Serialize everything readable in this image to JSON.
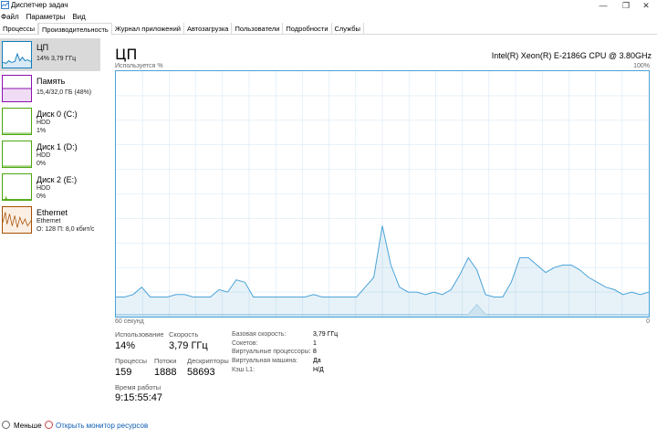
{
  "window": {
    "title": "Диспетчер задач",
    "accent": "#117dbb"
  },
  "menu": [
    "Файл",
    "Параметры",
    "Вид"
  ],
  "tabs": [
    "Процессы",
    "Производительность",
    "Журнал приложений",
    "Автозагрузка",
    "Пользователи",
    "Подробности",
    "Службы"
  ],
  "active_tab": "Производительность",
  "sidebar": [
    {
      "name": "ЦП",
      "sub1": "14% 3,79 ГГц",
      "sub2": "",
      "sub3": "",
      "color": "#117dbb"
    },
    {
      "name": "Память",
      "sub1": "15,4/32,0 ГБ (48%)",
      "sub2": "",
      "sub3": "",
      "color": "#8b12ae"
    },
    {
      "name": "Диск 0 (C:)",
      "sub1": "HDD",
      "sub2": "1%",
      "sub3": "",
      "color": "#4da60c"
    },
    {
      "name": "Диск 1 (D:)",
      "sub1": "HDD",
      "sub2": "0%",
      "sub3": "",
      "color": "#4da60c"
    },
    {
      "name": "Диск 2 (E:)",
      "sub1": "HDD",
      "sub2": "0%",
      "sub3": "",
      "color": "#4da60c"
    },
    {
      "name": "Ethernet",
      "sub1": "Ethernet",
      "sub2": "О: 128  П: 8,0 кбит/с",
      "sub3": "",
      "color": "#a74f01"
    }
  ],
  "main": {
    "title": "ЦП",
    "cpu_model": "Intel(R) Xeon(R) E-2186G CPU @ 3.80GHz",
    "graph_top_left": "Используется %",
    "graph_top_right": "100%",
    "graph_bottom_left": "60 секунд",
    "graph_bottom_right": "0",
    "cpu_history_percent": [
      8,
      8,
      9,
      12,
      8,
      8,
      8,
      9,
      9,
      8,
      8,
      8,
      11,
      10,
      15,
      14,
      8,
      8,
      8,
      8,
      8,
      8,
      8,
      9,
      8,
      8,
      8,
      8,
      8,
      12,
      16,
      37,
      21,
      12,
      10,
      10,
      9,
      10,
      9,
      11,
      17,
      24,
      19,
      9,
      8,
      8,
      14,
      24,
      24,
      21,
      18,
      20,
      21,
      21,
      19,
      16,
      14,
      12,
      11,
      9,
      10,
      9,
      10
    ],
    "kernel_history_percent": [
      1,
      1,
      1,
      1,
      1,
      1,
      1,
      1,
      1,
      1,
      1,
      1,
      1,
      1,
      1,
      1,
      1,
      1,
      1,
      1,
      1,
      1,
      1,
      1,
      1,
      1,
      1,
      1,
      1,
      1,
      1,
      1,
      1,
      1,
      1,
      1,
      1,
      1,
      1,
      1,
      1,
      1,
      5,
      1,
      1,
      1,
      1,
      1,
      1,
      1,
      1,
      1,
      1,
      1,
      1,
      1,
      1,
      1,
      1,
      1,
      1,
      1,
      1
    ],
    "stats": {
      "usage_label": "Использование",
      "usage_value": "14%",
      "speed_label": "Скорость",
      "speed_value": "3,79 ГГц",
      "processes_label": "Процессы",
      "processes_value": "159",
      "threads_label": "Потоки",
      "threads_value": "1888",
      "handles_label": "Дескрипторы",
      "handles_value": "58693",
      "uptime_label": "Время работы",
      "uptime_value": "9:15:55:47"
    },
    "specs": [
      {
        "label": "Базовая скорость:",
        "value": "3,79 ГГц"
      },
      {
        "label": "Сокетов:",
        "value": "1"
      },
      {
        "label": "Виртуальные процессоры:",
        "value": "8"
      },
      {
        "label": "Виртуальная машина:",
        "value": "Да"
      },
      {
        "label": "Кэш L1:",
        "value": "Н/Д"
      }
    ]
  },
  "footer": {
    "less_label": "Меньше",
    "monitor_link": "Открыть монитор ресурсов"
  }
}
